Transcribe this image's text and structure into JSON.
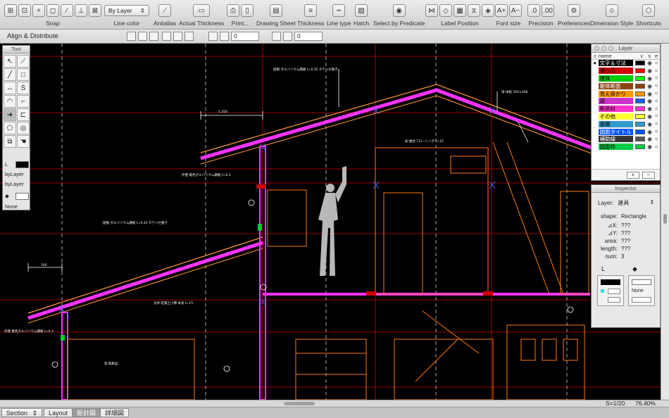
{
  "toolbar": {
    "snap_label": "Snap",
    "line_color_label": "Line color",
    "line_color_value": "By Layer",
    "antialias_label": "Antialias",
    "actual_thickness_label": "Actual Thickness",
    "print_label": "Print...",
    "drawing_sheet_label": "Drawing Sheet",
    "thickness_label": "Thickness",
    "line_type_label": "Line type",
    "hatch_label": "Hatch",
    "select_by_predicate_label": "Select by Predicate",
    "label_position_label": "Label Position",
    "font_size_label": "Font size",
    "precision_label": "Precision",
    "preferences_label": "Preferences",
    "dimension_style_label": "Dimension Style",
    "shortcuts_label": "Shortcuts"
  },
  "align": {
    "title": "Align & Distribute",
    "field1": "0",
    "field2": "0"
  },
  "tool_palette": {
    "title": "Tool",
    "line_color_value": "byLayer",
    "line_type_value": "byLayer",
    "fill_value": "None"
  },
  "layers": {
    "title": "Layer",
    "col_c": "c",
    "col_name": "name",
    "col_v": "v",
    "col_s": "s",
    "col_e": "e",
    "items": [
      {
        "name": "文字＆寸法",
        "bg": "#000000",
        "fg": "#ffffff",
        "flag": "#000000",
        "current": "true"
      },
      {
        "name": "通り芯",
        "bg": "#cc0000",
        "fg": "#000000",
        "flag": "#ff0000",
        "current": "false"
      },
      {
        "name": "建具",
        "bg": "#00cc00",
        "fg": "#000000",
        "flag": "#00ff00",
        "current": "false"
      },
      {
        "name": "躯体断面",
        "bg": "#8b4513",
        "fg": "#ffffff",
        "flag": "#8b4513",
        "current": "false"
      },
      {
        "name": "見え掛かり",
        "bg": "#ff9900",
        "fg": "#000000",
        "flag": "#ff9900",
        "current": "false"
      },
      {
        "name": "梁",
        "bg": "#cc33cc",
        "fg": "#000000",
        "flag": "#0066ff",
        "current": "false"
      },
      {
        "name": "断熱材",
        "bg": "#ff33cc",
        "fg": "#000000",
        "flag": "#ff33cc",
        "current": "false"
      },
      {
        "name": "その他",
        "bg": "#ffff33",
        "fg": "#000000",
        "flag": "#ffff33",
        "current": "false"
      },
      {
        "name": "基礎",
        "bg": "#3399cc",
        "fg": "#000000",
        "flag": "#3399cc",
        "current": "false"
      },
      {
        "name": "図面タイトル",
        "bg": "#0055ff",
        "fg": "#ffffff",
        "flag": "#0055ff",
        "current": "false"
      },
      {
        "name": "補助線",
        "bg": "#333333",
        "fg": "#ffffff",
        "flag": "#555555",
        "current": "false"
      },
      {
        "name": "図面枠",
        "bg": "#00cc44",
        "fg": "#000000",
        "flag": "#00cc44",
        "current": "false"
      }
    ],
    "add": "+",
    "remove": "−"
  },
  "inspector": {
    "title": "Inspector",
    "layer_label": "Layer:",
    "layer_value": "建具",
    "shape_label": "shape:",
    "shape_value": "Rectangle",
    "dx_label": "⊿X:",
    "dx_value": "???",
    "dy_label": "⊿Y:",
    "dy_value": "???",
    "area_label": "area:",
    "area_value": "???",
    "length_label": "length:",
    "length_value": "???",
    "num_label": "num:",
    "num_value": "3",
    "fill_value": "None"
  },
  "status": {
    "scale": "S=1/20",
    "zoom": "76.40%"
  },
  "tabs": {
    "section": "Section",
    "layout": "Layout",
    "tab3": "矩計図",
    "tab4": "詳細図"
  },
  "drawing": {
    "dim1": "1,250",
    "dim2": "760",
    "note_roof": "屋根:ガルバリウム鋼板 t=0.35 タテハゼ葺き",
    "note_wall": "外壁:着色ガルバリウム鋼板 t=0.3",
    "note_ceiling": "天井:珪藻土小節 本実 t=15",
    "note_floor": "床:複合フローリング t=15",
    "note_beam": "梁:米松 105×300",
    "note_window": "窓:既製品",
    "colors": {
      "accent": "#ff33ff",
      "wall": "#ff6600",
      "grid": "#cc0000",
      "dim": "#ffffff"
    }
  }
}
